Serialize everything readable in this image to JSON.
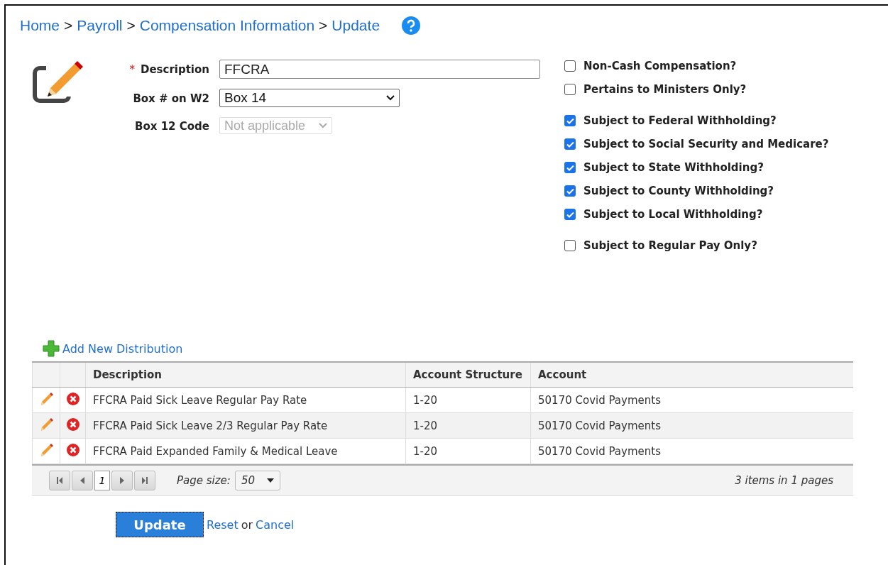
{
  "breadcrumb": [
    {
      "label": "Home",
      "separator": ">"
    },
    {
      "label": "Payroll",
      "separator": ">"
    },
    {
      "label": "Compensation Information",
      "separator": ">"
    },
    {
      "label": "Update"
    }
  ],
  "form": {
    "fields": [
      {
        "kind": "text",
        "label": "Description",
        "required": true,
        "required_mark": "*",
        "value": "FFCRA"
      },
      {
        "kind": "select",
        "label": "Box # on W2",
        "value": "Box 14",
        "disabled": false
      },
      {
        "kind": "select",
        "label": "Box 12 Code",
        "value": "Not applicable",
        "disabled": true
      }
    ],
    "checkbox_groups": [
      [
        {
          "label": "Non-Cash Compensation?",
          "checked": false
        },
        {
          "label": "Pertains to Ministers Only?",
          "checked": false
        }
      ],
      [
        {
          "label": "Subject to Federal Withholding?",
          "checked": true
        },
        {
          "label": "Subject to Social Security and Medicare?",
          "checked": true
        },
        {
          "label": "Subject to State Withholding?",
          "checked": true
        },
        {
          "label": "Subject to County Withholding?",
          "checked": true
        },
        {
          "label": "Subject to Local Withholding?",
          "checked": true
        }
      ],
      [
        {
          "label": "Subject to Regular Pay Only?",
          "checked": false
        }
      ]
    ]
  },
  "add_link": "Add New Distribution",
  "table": {
    "columns": [
      "Description",
      "Account Structure",
      "Account"
    ],
    "rows": [
      [
        "FFCRA Paid Sick Leave Regular Pay Rate",
        "1-20",
        "50170 Covid Payments"
      ],
      [
        "FFCRA Paid Sick Leave 2/3 Regular Pay Rate",
        "1-20",
        "50170 Covid Payments"
      ],
      [
        "FFCRA Paid Expanded Family & Medical Leave",
        "1-20",
        "50170 Covid Payments"
      ]
    ],
    "pager": {
      "page": "1",
      "page_size_label": "Page size:",
      "page_size": "50",
      "summary": "3 items in 1 pages"
    }
  },
  "actions": {
    "primary": "Update",
    "reset": "Reset",
    "or": "or",
    "cancel": "Cancel"
  }
}
